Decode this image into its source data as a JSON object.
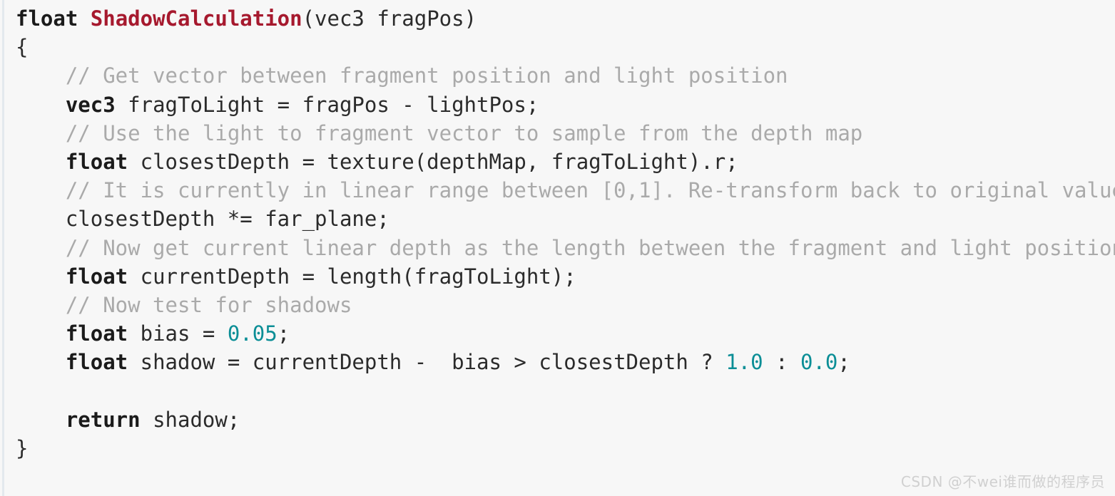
{
  "snippet": {
    "language": "glsl",
    "background_color": "#f7f7f7",
    "gutter_stripe_color": "#e3e9ee",
    "font_size_px": 29,
    "line_height_px": 40,
    "colors": {
      "keyword": "#1b1b1b",
      "function_name": "#a6192e",
      "plain": "#2b2b2b",
      "comment": "#aaaaaa",
      "number": "#0b8e96"
    },
    "lines": [
      {
        "index": 1,
        "text": "float ShadowCalculation(vec3 fragPos)",
        "tokens": [
          {
            "t": "float",
            "k": "kw"
          },
          {
            "t": " ",
            "k": "pl"
          },
          {
            "t": "ShadowCalculation",
            "k": "fn"
          },
          {
            "t": "(vec3 fragPos)",
            "k": "pl"
          }
        ]
      },
      {
        "index": 2,
        "text": "{",
        "tokens": [
          {
            "t": "{",
            "k": "pl"
          }
        ]
      },
      {
        "index": 3,
        "text": "    // Get vector between fragment position and light position",
        "tokens": [
          {
            "t": "    ",
            "k": "pl"
          },
          {
            "t": "// Get vector between fragment position and light position",
            "k": "cm"
          }
        ]
      },
      {
        "index": 4,
        "text": "    vec3 fragToLight = fragPos - lightPos;",
        "tokens": [
          {
            "t": "    ",
            "k": "pl"
          },
          {
            "t": "vec3",
            "k": "kw"
          },
          {
            "t": " fragToLight = fragPos - lightPos;",
            "k": "pl"
          }
        ]
      },
      {
        "index": 5,
        "text": "    // Use the light to fragment vector to sample from the depth map",
        "tokens": [
          {
            "t": "    ",
            "k": "pl"
          },
          {
            "t": "// Use the light to fragment vector to sample from the depth map",
            "k": "cm"
          }
        ]
      },
      {
        "index": 6,
        "text": "    float closestDepth = texture(depthMap, fragToLight).r;",
        "tokens": [
          {
            "t": "    ",
            "k": "pl"
          },
          {
            "t": "float",
            "k": "kw"
          },
          {
            "t": " closestDepth = texture(depthMap, fragToLight).r;",
            "k": "pl"
          }
        ]
      },
      {
        "index": 7,
        "text": "    // It is currently in linear range between [0,1]. Re-transform back to original value",
        "tokens": [
          {
            "t": "    ",
            "k": "pl"
          },
          {
            "t": "// It is currently in linear range between [0,1]. Re-transform back to original value",
            "k": "cm"
          }
        ]
      },
      {
        "index": 8,
        "text": "    closestDepth *= far_plane;",
        "tokens": [
          {
            "t": "    closestDepth *= far_plane;",
            "k": "pl"
          }
        ]
      },
      {
        "index": 9,
        "text": "    // Now get current linear depth as the length between the fragment and light position",
        "tokens": [
          {
            "t": "    ",
            "k": "pl"
          },
          {
            "t": "// Now get current linear depth as the length between the fragment and light position",
            "k": "cm"
          }
        ]
      },
      {
        "index": 10,
        "text": "    float currentDepth = length(fragToLight);",
        "tokens": [
          {
            "t": "    ",
            "k": "pl"
          },
          {
            "t": "float",
            "k": "kw"
          },
          {
            "t": " currentDepth = length(fragToLight);",
            "k": "pl"
          }
        ]
      },
      {
        "index": 11,
        "text": "    // Now test for shadows",
        "tokens": [
          {
            "t": "    ",
            "k": "pl"
          },
          {
            "t": "// Now test for shadows",
            "k": "cm"
          }
        ]
      },
      {
        "index": 12,
        "text": "    float bias = 0.05;",
        "tokens": [
          {
            "t": "    ",
            "k": "pl"
          },
          {
            "t": "float",
            "k": "kw"
          },
          {
            "t": " bias = ",
            "k": "pl"
          },
          {
            "t": "0.05",
            "k": "num"
          },
          {
            "t": ";",
            "k": "pl"
          }
        ]
      },
      {
        "index": 13,
        "text": "    float shadow = currentDepth -  bias > closestDepth ? 1.0 : 0.0;",
        "tokens": [
          {
            "t": "    ",
            "k": "pl"
          },
          {
            "t": "float",
            "k": "kw"
          },
          {
            "t": " shadow = currentDepth -  bias > closestDepth ? ",
            "k": "pl"
          },
          {
            "t": "1.0",
            "k": "num"
          },
          {
            "t": " : ",
            "k": "pl"
          },
          {
            "t": "0.0",
            "k": "num"
          },
          {
            "t": ";",
            "k": "pl"
          }
        ]
      },
      {
        "index": 14,
        "text": "",
        "tokens": []
      },
      {
        "index": 15,
        "text": "    return shadow;",
        "tokens": [
          {
            "t": "    ",
            "k": "pl"
          },
          {
            "t": "return",
            "k": "kw"
          },
          {
            "t": " shadow;",
            "k": "pl"
          }
        ]
      },
      {
        "index": 16,
        "text": "}",
        "tokens": [
          {
            "t": "}",
            "k": "pl"
          }
        ]
      }
    ]
  },
  "watermark": {
    "text": "CSDN @不wei谁而做的程序员",
    "color": "#d0d0d0"
  }
}
